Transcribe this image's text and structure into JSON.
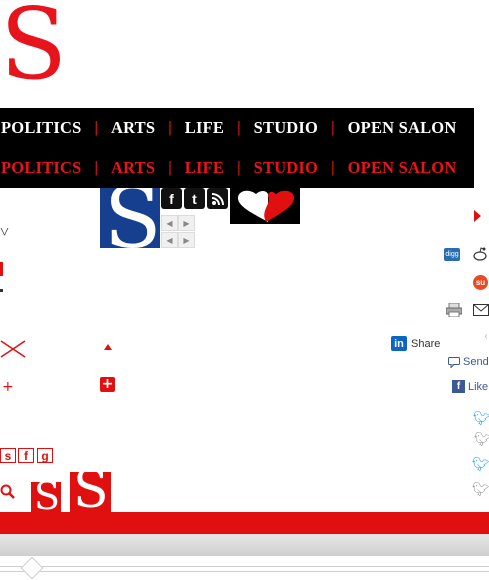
{
  "brand": {
    "logo_letter": "S"
  },
  "nav": {
    "items": [
      "POLITICS",
      "ARTS",
      "LIFE",
      "STUDIO",
      "OPEN SALON"
    ],
    "separator": "|"
  },
  "social_share": {
    "linkedin_label": "Share",
    "linkedin_glyph": "in",
    "send_label": "Send",
    "like_label": "Like",
    "facebook_glyph": "f"
  },
  "sfg_icons": [
    "s",
    "f",
    "g"
  ],
  "small_s_letter": "S",
  "colors": {
    "brand_red": "#e8141c",
    "nav_bg": "#000000",
    "blue": "#163f8f"
  }
}
